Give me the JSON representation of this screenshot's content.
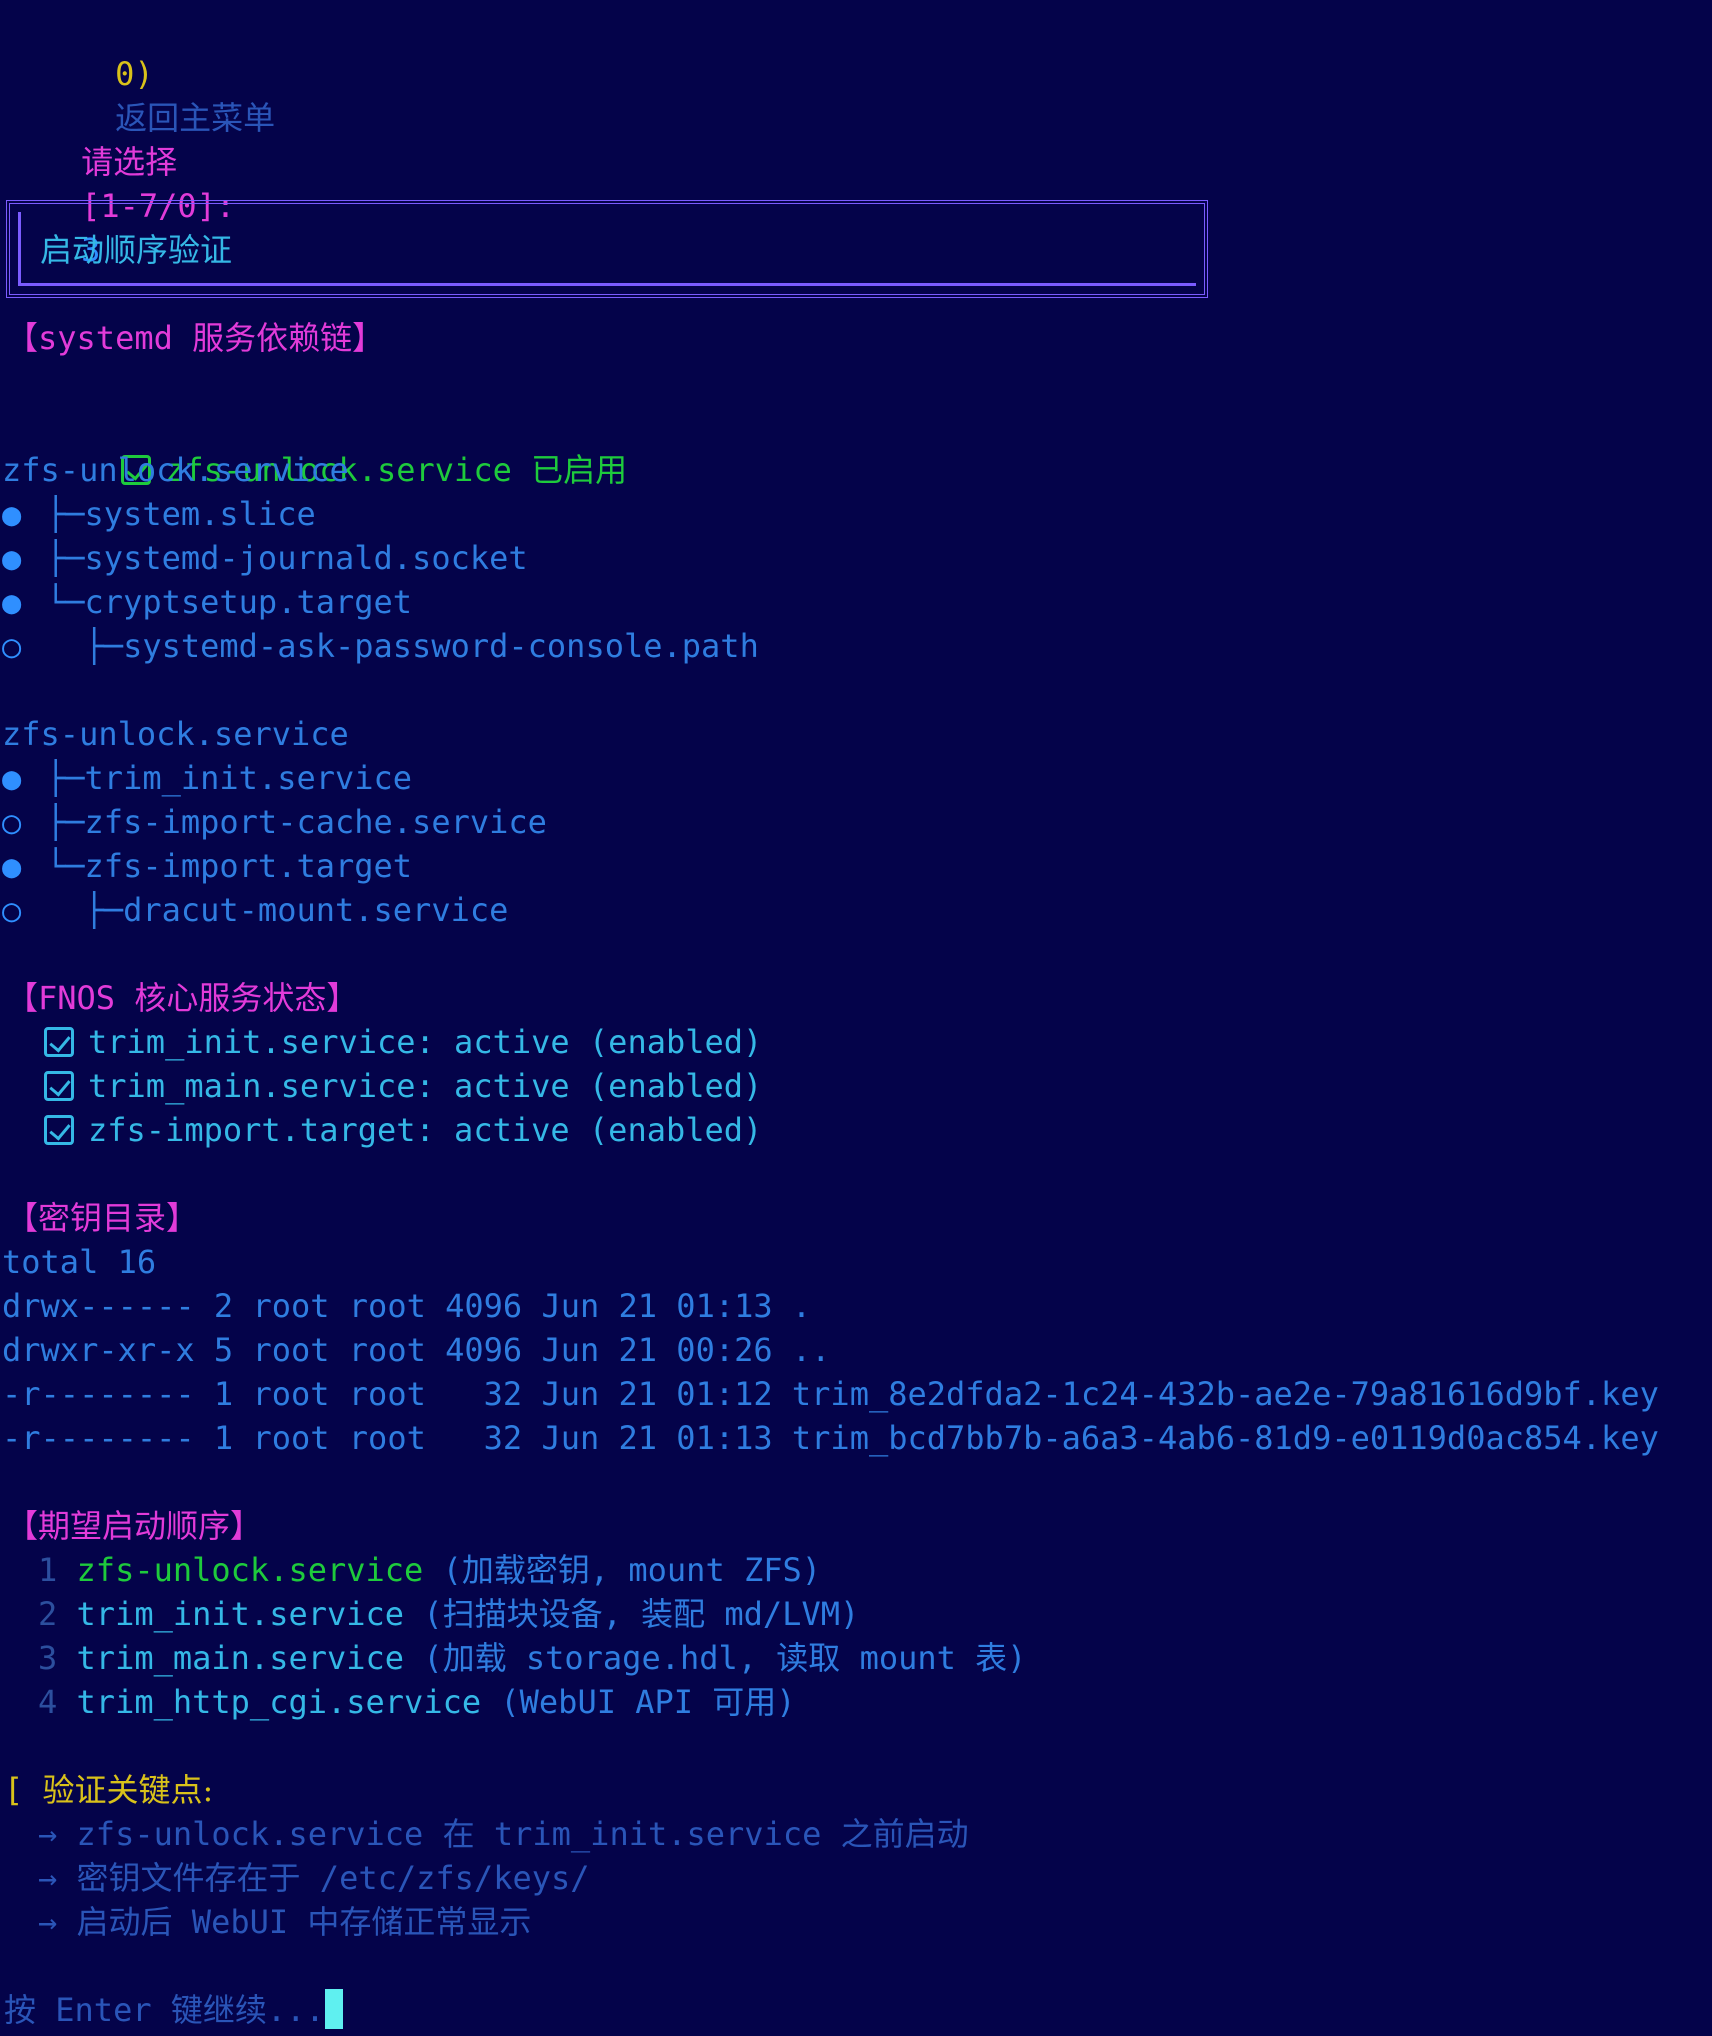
{
  "menu": {
    "back_key": "0)",
    "back_label": "返回主菜单"
  },
  "prompt": {
    "label": "请选择",
    "range": "[1-7/0]:",
    "value": "3"
  },
  "title": "启动顺序验证",
  "deps": {
    "header": "【systemd 服务依赖链】",
    "enabled_line": {
      "service": "zfs-unlock.service",
      "status": "已启用"
    },
    "tree1": {
      "root": "zfs-unlock.service",
      "items": [
        {
          "bullet": "●",
          "prefix": "├─",
          "name": "system.slice"
        },
        {
          "bullet": "●",
          "prefix": "├─",
          "name": "systemd-journald.socket"
        },
        {
          "bullet": "●",
          "prefix": "└─",
          "name": "cryptsetup.target"
        },
        {
          "bullet": "○",
          "prefix": "  ├─",
          "name": "systemd-ask-password-console.path"
        }
      ]
    },
    "tree2": {
      "root": "zfs-unlock.service",
      "items": [
        {
          "bullet": "●",
          "prefix": "├─",
          "name": "trim_init.service"
        },
        {
          "bullet": "○",
          "prefix": "├─",
          "name": "zfs-import-cache.service"
        },
        {
          "bullet": "●",
          "prefix": "└─",
          "name": "zfs-import.target"
        },
        {
          "bullet": "○",
          "prefix": "  ├─",
          "name": "dracut-mount.service"
        }
      ]
    }
  },
  "fnos": {
    "header": "【FNOS 核心服务状态】",
    "items": [
      "trim_init.service: active (enabled)",
      "trim_main.service: active (enabled)",
      "zfs-import.target: active (enabled)"
    ]
  },
  "keys": {
    "header": "【密钥目录】",
    "total": "total 16",
    "rows": [
      "drwx------ 2 root root 4096 Jun 21 01:13 .",
      "drwxr-xr-x 5 root root 4096 Jun 21 00:26 ..",
      "-r-------- 1 root root   32 Jun 21 01:12 trim_8e2dfda2-1c24-432b-ae2e-79a81616d9bf.key",
      "-r-------- 1 root root   32 Jun 21 01:13 trim_bcd7bb7b-a6a3-4ab6-81d9-e0119d0ac854.key"
    ]
  },
  "order": {
    "header": "【期望启动顺序】",
    "items": [
      {
        "num": "1",
        "service": "zfs-unlock.service",
        "desc": "(加载密钥, mount ZFS)"
      },
      {
        "num": "2",
        "service": "trim_init.service",
        "desc": "(扫描块设备, 装配 md/LVM)"
      },
      {
        "num": "3",
        "service": "trim_main.service",
        "desc": "(加载 storage.hdl, 读取 mount 表)"
      },
      {
        "num": "4",
        "service": "trim_http_cgi.service",
        "desc": "(WebUI API 可用)"
      }
    ]
  },
  "verify": {
    "bracket": "[",
    "header": "验证关键点:",
    "items": [
      "→ zfs-unlock.service 在 trim_init.service 之前启动",
      "→ 密钥文件存在于 /etc/zfs/keys/",
      "→ 启动后 WebUI 中存储正常显示"
    ]
  },
  "footer": {
    "continue": "按 Enter 键继续..."
  },
  "colors": {
    "background": "#04034a",
    "blue": "#2f7de0",
    "cyan": "#35b8e6",
    "green": "#1ecb3c",
    "magenta": "#e23bd9",
    "yellow": "#d9c21a",
    "border": "#7b5cff",
    "cursor": "#5ff0f0"
  }
}
